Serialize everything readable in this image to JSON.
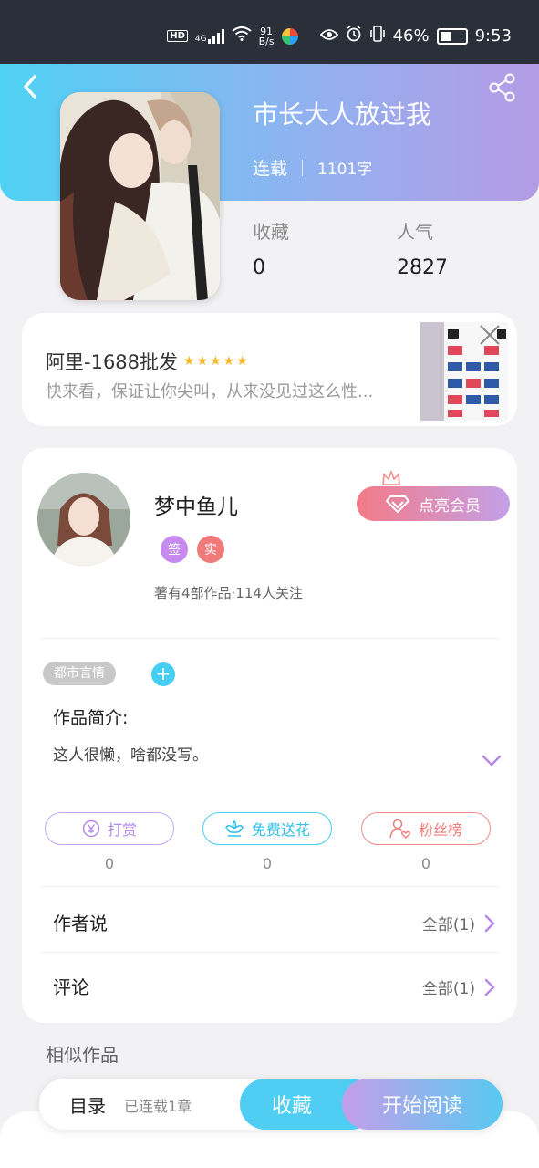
{
  "status_bar": {
    "hd": "HD",
    "signal": "4G",
    "net_speed_value": "91",
    "net_speed_unit": "B/s",
    "battery": "46%",
    "time": "9:53"
  },
  "book": {
    "title": "市长大人放过我",
    "status": "连载",
    "word_count": "1101字",
    "stats": [
      {
        "label": "收藏",
        "value": "0"
      },
      {
        "label": "人气",
        "value": "2827"
      }
    ]
  },
  "ad": {
    "title": "阿里-1688批发",
    "stars": "★★★★★",
    "rating": 5,
    "description": "快来看，保证让你尖叫，从来没见过这么性..."
  },
  "author": {
    "name": "梦中鱼儿",
    "badges": [
      "签",
      "实"
    ],
    "stats": "著有4部作品·114人关注",
    "vip_button": "点亮会员"
  },
  "work": {
    "tag": "都市言情",
    "add_tag": "+",
    "intro_label": "作品简介:",
    "intro_text": "这人很懒，啥都没写。"
  },
  "actions": [
    {
      "label": "打赏",
      "count": "0"
    },
    {
      "label": "免费送花",
      "count": "0"
    },
    {
      "label": "粉丝榜",
      "count": "0"
    }
  ],
  "sections": {
    "author_says": {
      "title": "作者说",
      "all": "全部(1)"
    },
    "comments": {
      "title": "评论",
      "all": "全部(1)"
    },
    "similar_title": "相似作品"
  },
  "bottom_bar": {
    "catalog": "目录",
    "chapters": "已连载1章",
    "favorite": "收藏",
    "start_reading": "开始阅读"
  },
  "colors": {
    "header_start": "#4fd2f5",
    "header_end": "#b59be6",
    "accent_cyan": "#45cdf2",
    "accent_purple": "#c49ee9",
    "accent_red": "#f07a7a"
  }
}
